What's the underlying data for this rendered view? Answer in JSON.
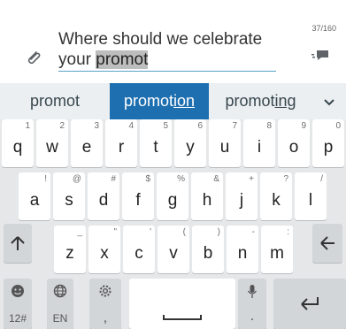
{
  "compose": {
    "text_before": "Where should we celebrate your ",
    "text_highlighted": "promot",
    "char_counter": "37/160",
    "icons": [
      "paperclip-icon",
      "send-icon"
    ]
  },
  "suggestions": {
    "s1": "promot",
    "s2_prefix": "promot",
    "s2_suffix": "ion",
    "s3_prefix": "promot",
    "s3_suffix": "ing",
    "expand_icon": "chevron-down-icon",
    "highlight_color": "#1e6fb0"
  },
  "keyboard": {
    "row1": [
      {
        "main": "q",
        "alt": "1"
      },
      {
        "main": "w",
        "alt": "2"
      },
      {
        "main": "e",
        "alt": "3"
      },
      {
        "main": "r",
        "alt": "4"
      },
      {
        "main": "t",
        "alt": "5"
      },
      {
        "main": "y",
        "alt": "6"
      },
      {
        "main": "u",
        "alt": "7"
      },
      {
        "main": "i",
        "alt": "8"
      },
      {
        "main": "o",
        "alt": "9"
      },
      {
        "main": "p",
        "alt": "0"
      }
    ],
    "row2": [
      {
        "main": "a",
        "alt": "!"
      },
      {
        "main": "s",
        "alt": "@"
      },
      {
        "main": "d",
        "alt": "#"
      },
      {
        "main": "f",
        "alt": "$"
      },
      {
        "main": "g",
        "alt": "%"
      },
      {
        "main": "h",
        "alt": "&"
      },
      {
        "main": "j",
        "alt": "+"
      },
      {
        "main": "k",
        "alt": "?"
      },
      {
        "main": "l",
        "alt": "/"
      }
    ],
    "row3": [
      {
        "main": "z",
        "alt": "_"
      },
      {
        "main": "x",
        "alt": "\""
      },
      {
        "main": "c",
        "alt": "'"
      },
      {
        "main": "v",
        "alt": "("
      },
      {
        "main": "b",
        "alt": ")"
      },
      {
        "main": "n",
        "alt": "-"
      },
      {
        "main": "m",
        "alt": ":"
      }
    ],
    "shift_icon": "shift-arrow-icon",
    "backspace_icon": "backspace-arrow-icon",
    "symbols_label": "12#",
    "language_label": "EN",
    "comma_label": ",",
    "period_label": ".",
    "enter_icon": "enter-icon"
  }
}
